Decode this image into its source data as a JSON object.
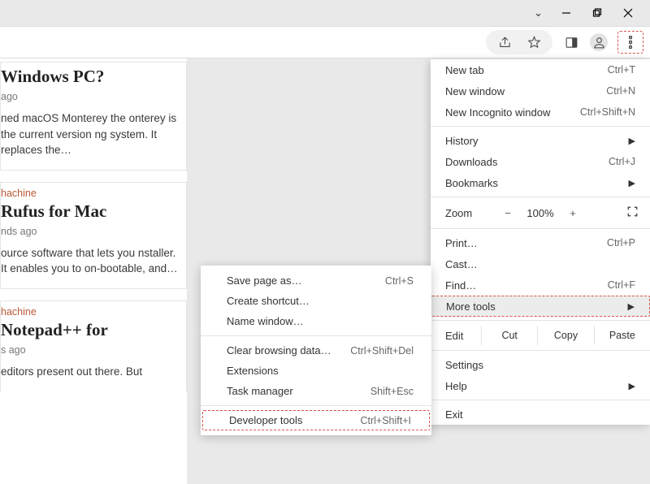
{
  "titlebar": {},
  "toolbar": {},
  "articles": [
    {
      "cat": "",
      "title": "Windows PC?",
      "byline": "ago",
      "body": "ned macOS Monterey the onterey is the current version ng system. It replaces the…"
    },
    {
      "cat": "hachine",
      "title": "Rufus for Mac",
      "byline": "nds ago",
      "body": "ource software that lets you nstaller. It enables you to on-bootable, and…"
    },
    {
      "cat": "hachine",
      "title": "Notepad++ for",
      "byline": "s ago",
      "body": "editors present out there. But"
    }
  ],
  "menu": {
    "newtab": {
      "label": "New tab",
      "shortcut": "Ctrl+T"
    },
    "newwin": {
      "label": "New window",
      "shortcut": "Ctrl+N"
    },
    "incognito": {
      "label": "New Incognito window",
      "shortcut": "Ctrl+Shift+N"
    },
    "history": {
      "label": "History"
    },
    "downloads": {
      "label": "Downloads",
      "shortcut": "Ctrl+J"
    },
    "bookmarks": {
      "label": "Bookmarks"
    },
    "zoom": {
      "label": "Zoom",
      "minus": "−",
      "pct": "100%",
      "plus": "+"
    },
    "print": {
      "label": "Print…",
      "shortcut": "Ctrl+P"
    },
    "cast": {
      "label": "Cast…"
    },
    "find": {
      "label": "Find…",
      "shortcut": "Ctrl+F"
    },
    "moretools": {
      "label": "More tools"
    },
    "edit": {
      "label": "Edit",
      "cut": "Cut",
      "copy": "Copy",
      "paste": "Paste"
    },
    "settings": {
      "label": "Settings"
    },
    "help": {
      "label": "Help"
    },
    "exit": {
      "label": "Exit"
    }
  },
  "submenu": {
    "savepage": {
      "label": "Save page as…",
      "shortcut": "Ctrl+S"
    },
    "shortcut": {
      "label": "Create shortcut…"
    },
    "namewindow": {
      "label": "Name window…"
    },
    "clearbrowse": {
      "label": "Clear browsing data…",
      "shortcut": "Ctrl+Shift+Del"
    },
    "extensions": {
      "label": "Extensions"
    },
    "taskmgr": {
      "label": "Task manager",
      "shortcut": "Shift+Esc"
    },
    "devtools": {
      "label": "Developer tools",
      "shortcut": "Ctrl+Shift+I"
    }
  }
}
